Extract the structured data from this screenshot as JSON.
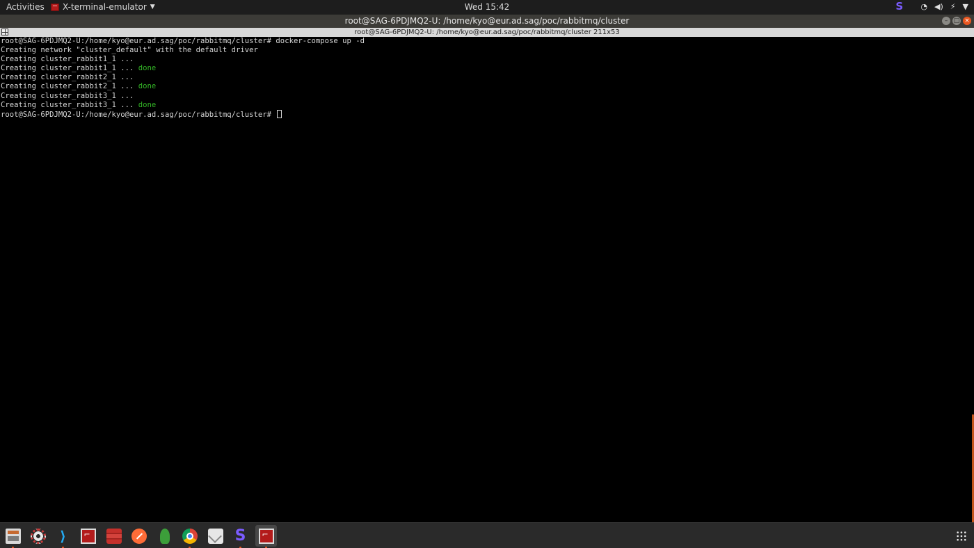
{
  "top_panel": {
    "activities": "Activities",
    "app_menu_label": "X-terminal-emulator",
    "clock": "Wed 15:42",
    "tray_icons": [
      "sublime-icon",
      "wifi-icon",
      "volume-icon",
      "battery-icon",
      "system-menu-icon"
    ]
  },
  "window": {
    "title": "root@SAG-6PDJMQ2-U: /home/kyo@eur.ad.sag/poc/rabbitmq/cluster",
    "xterm_status": "root@SAG-6PDJMQ2-U: /home/kyo@eur.ad.sag/poc/rabbitmq/cluster 211x53"
  },
  "terminal": {
    "line0_prompt": "root@SAG-6PDJMQ2-U:/home/kyo@eur.ad.sag/poc/rabbitmq/cluster# docker-compose up -d",
    "line1": "Creating network \"cluster_default\" with the default driver",
    "line2": "Creating cluster_rabbit1_1 ...",
    "line3": "Creating cluster_rabbit1_1 ... ",
    "line3_status": "done",
    "line4": "Creating cluster_rabbit2_1 ...",
    "line5": "Creating cluster_rabbit2_1 ... ",
    "line5_status": "done",
    "line6": "Creating cluster_rabbit3_1 ...",
    "line7": "Creating cluster_rabbit3_1 ... ",
    "line7_status": "done",
    "line8_prompt": "root@SAG-6PDJMQ2-U:/home/kyo@eur.ad.sag/poc/rabbitmq/cluster# "
  },
  "colors": {
    "done_green": "#33b526",
    "accent_orange": "#e9561f",
    "terminal_bg": "#000000"
  },
  "dock": {
    "items": [
      "files-icon",
      "settings-gear-icon",
      "vscode-icon",
      "terminal-icon",
      "redis-icon",
      "postman-icon",
      "rocket-icon",
      "chrome-icon",
      "mail-icon",
      "sublime-text-icon",
      "xterm-icon"
    ],
    "show_apps": "show-applications-icon"
  }
}
